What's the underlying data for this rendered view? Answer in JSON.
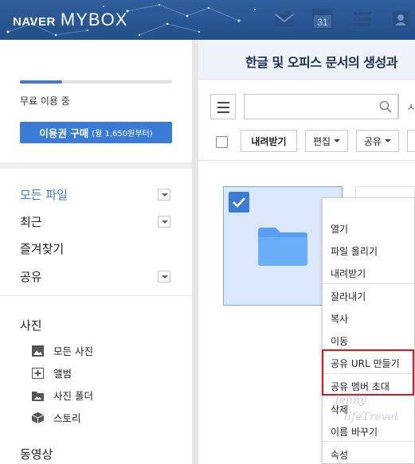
{
  "header": {
    "brand_naver": "NAVER",
    "brand_mybox": "MYBOX",
    "calendar_day": "31",
    "icons": [
      "mail-icon",
      "calendar-icon",
      "list-icon",
      "contacts-icon",
      "grid-icon"
    ]
  },
  "sidebar": {
    "usage_percent": 28,
    "usage_text": "무료 이용 중",
    "buy_button": {
      "label": "이용권 구매",
      "sub": "(월 1,650원부터)"
    },
    "nav": [
      {
        "label": "모든 파일",
        "active": true,
        "dropdown": true
      },
      {
        "label": "최근",
        "active": false,
        "dropdown": true
      },
      {
        "label": "즐겨찾기",
        "active": false,
        "dropdown": false
      },
      {
        "label": "공유",
        "active": false,
        "dropdown": true
      }
    ],
    "photo_section": {
      "title": "사진",
      "items": [
        {
          "label": "모든 사진",
          "icon": "photo-icon"
        },
        {
          "label": "앨범",
          "icon": "album-icon"
        },
        {
          "label": "사진 폴더",
          "icon": "photo-folder-icon"
        },
        {
          "label": "스토리",
          "icon": "story-icon"
        }
      ]
    },
    "video_section_title": "동영상"
  },
  "main": {
    "promo_text": "한글 및 오피스 문서의 생성과",
    "search_cut": "ㅅ",
    "toolbar": {
      "download": "내려받기",
      "edit": "편집",
      "share": "공유"
    }
  },
  "context_menu": {
    "groups": [
      [
        "열기",
        "파일 올리기",
        "내려받기"
      ],
      [
        "잘라내기",
        "복사",
        "이동"
      ],
      [
        "공유 URL 만들기",
        "공유 멤버 초대"
      ],
      [
        "삭제",
        "이름 바꾸기"
      ],
      [
        "속성"
      ]
    ],
    "highlight_color": "#e0141e"
  },
  "watermark": {
    "line1": "Jenny",
    "line2": "lifeTrevel"
  },
  "colors": {
    "accent": "#3a7bd5",
    "header": "#2a5690"
  }
}
